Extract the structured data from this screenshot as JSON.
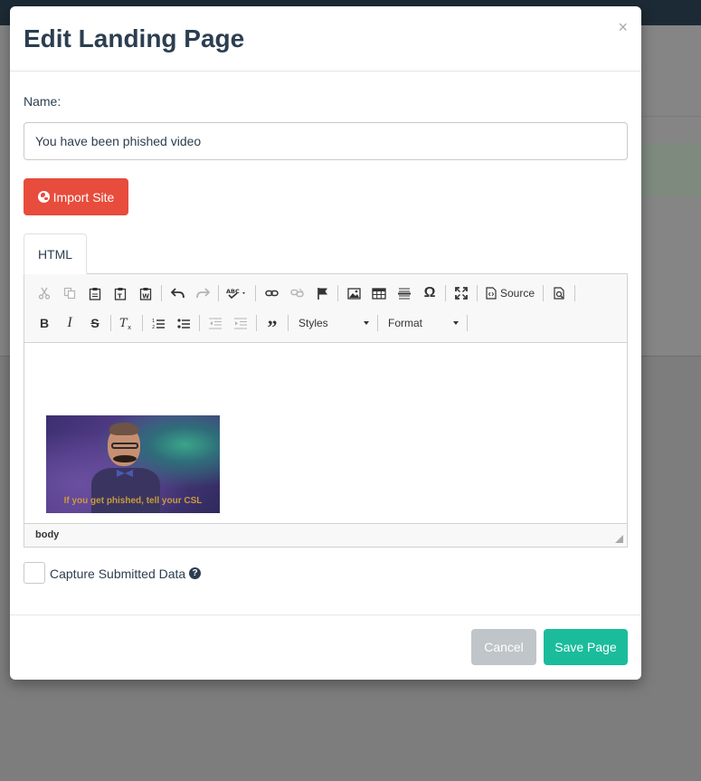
{
  "modal": {
    "title": "Edit Landing Page",
    "close_glyph": "×"
  },
  "form": {
    "name_label": "Name:",
    "name_value": "You have been phished video",
    "import_button_label": "Import Site",
    "import_button_icon": "globe-icon",
    "capture_label": "Capture Submitted Data",
    "capture_checked": false
  },
  "editor": {
    "tabs": [
      {
        "label": "HTML",
        "active": true
      }
    ],
    "toolbar_row1": [
      "cut-icon",
      "copy-icon",
      "paste-icon",
      "paste-text-icon",
      "paste-word-icon",
      "undo-icon",
      "redo-icon",
      "spellcheck-icon",
      "link-icon",
      "unlink-icon",
      "anchor-flag-icon",
      "image-icon",
      "table-icon",
      "horizontal-line-icon",
      "special-char-icon",
      "maximize-icon",
      "source-icon",
      "preview-icon"
    ],
    "source_label": "Source",
    "toolbar_row2": [
      "bold-icon",
      "italic-icon",
      "strikethrough-icon",
      "remove-format-icon",
      "numbered-list-icon",
      "bulleted-list-icon",
      "outdent-icon",
      "indent-icon",
      "blockquote-icon"
    ],
    "styles_label": "Styles",
    "format_label": "Format",
    "gif_caption": "If you get phished, tell your CSL",
    "status_path": "body"
  },
  "footer": {
    "cancel_label": "Cancel",
    "save_label": "Save Page"
  },
  "colors": {
    "danger": "#e74c3c",
    "success": "#1abc9c",
    "muted": "#bfc5c8",
    "text": "#2c3e50"
  }
}
